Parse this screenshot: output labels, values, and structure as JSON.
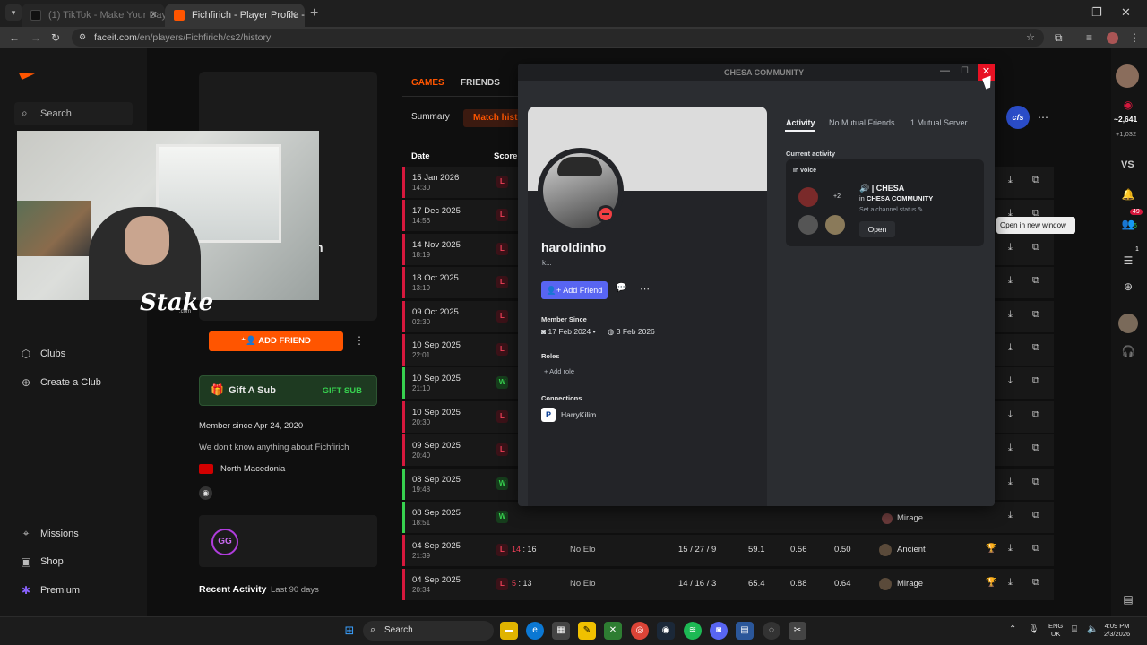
{
  "browser": {
    "tabs": [
      {
        "title": "(1) TikTok - Make Your Day"
      },
      {
        "title": "Fichfirich - Player Profile - FACE"
      }
    ],
    "url_host": "faceit.com",
    "url_path": "/en/players/Fichfirich/cs2/history"
  },
  "nav": {
    "search_placeholder": "Search",
    "clubs": "Clubs",
    "create_club": "Create a Club",
    "missions": "Missions",
    "shop": "Shop",
    "premium": "Premium"
  },
  "stream": {
    "sponsor": "Stake",
    "sponsor_sub": ".com"
  },
  "profile": {
    "name_fragment": "n",
    "add_friend": "ADD FRIEND",
    "gift_title": "Gift A Sub",
    "gift_button": "GIFT SUB",
    "member_since": "Member since Apr 24, 2020",
    "about": "We don't know anything about Fichfirich",
    "country": "North Macedonia",
    "gg_badge": "GG",
    "recent_activity": "Recent Activity",
    "recent_range": "Last 90 days"
  },
  "tabs": {
    "games": "GAMES",
    "friends": "FRIENDS",
    "summary": "Summary",
    "match_history": "Match hist"
  },
  "table": {
    "headers": {
      "date": "Date",
      "score": "Score"
    },
    "rows": [
      {
        "date": "15 Jan 2026",
        "time": "14:30",
        "result": "L"
      },
      {
        "date": "17 Dec 2025",
        "time": "14:56",
        "result": "L"
      },
      {
        "date": "14 Nov 2025",
        "time": "18:19",
        "result": "L"
      },
      {
        "date": "18 Oct 2025",
        "time": "13:19",
        "result": "L"
      },
      {
        "date": "09 Oct 2025",
        "time": "02:30",
        "result": "L"
      },
      {
        "date": "10 Sep 2025",
        "time": "22:01",
        "result": "L"
      },
      {
        "date": "10 Sep 2025",
        "time": "21:10",
        "result": "W"
      },
      {
        "date": "10 Sep 2025",
        "time": "20:30",
        "result": "L"
      },
      {
        "date": "09 Sep 2025",
        "time": "20:40",
        "result": "L"
      },
      {
        "date": "08 Sep 2025",
        "time": "19:48",
        "result": "W"
      },
      {
        "date": "08 Sep 2025",
        "time": "18:51",
        "result": "W"
      },
      {
        "date": "04 Sep 2025",
        "time": "21:39",
        "result": "L",
        "score_l": "14",
        "score_r": "16",
        "elo": "No Elo",
        "kda": "15 / 27 / 9",
        "hs": "59.1",
        "kd": "0.56",
        "kr": "0.50",
        "map": "Ancient"
      },
      {
        "date": "04 Sep 2025",
        "time": "20:34",
        "result": "L",
        "score_l": "5",
        "score_r": "13",
        "elo": "No Elo",
        "kda": "14 / 16 / 3",
        "hs": "65.4",
        "kd": "0.88",
        "kr": "0.64",
        "map": "Mirage"
      }
    ],
    "partial_row_map": "Mirage"
  },
  "rightrail": {
    "elo_main": "~2,641",
    "elo_sub": "+1,032",
    "vs": "VS",
    "badge_count": "49",
    "badge_sub": "6",
    "badge_1": "1",
    "cs_badge": "cfs",
    "tooltip": "Open in new window"
  },
  "discord": {
    "window_title": "CHESA COMMUNITY",
    "username": "haroldinho",
    "tag": "k...",
    "add_friend": "Add Friend",
    "member_since_label": "Member Since",
    "member_since_discord": "17 Feb 2024",
    "member_since_server": "3 Feb 2026",
    "roles_label": "Roles",
    "add_role": "Add role",
    "connections_label": "Connections",
    "connection_name": "HarryKilim",
    "tabs": [
      "Activity",
      "No Mutual Friends",
      "1 Mutual Server"
    ],
    "current_activity": "Current activity",
    "in_voice": "In voice",
    "voice_extra": "+2",
    "channel": "| CHESA",
    "channel_in": "in",
    "channel_server": "CHESA COMMUNITY",
    "channel_status": "Set a channel status",
    "open": "Open"
  },
  "taskbar": {
    "search": "Search",
    "lang_1": "ENG",
    "lang_2": "UK",
    "time": "4:09 PM",
    "date": "2/3/2026"
  },
  "colors": {
    "faceit_orange": "#ff5500",
    "loss": "#d6183d",
    "win": "#37d14f",
    "discord_blurple": "#5865f2"
  }
}
